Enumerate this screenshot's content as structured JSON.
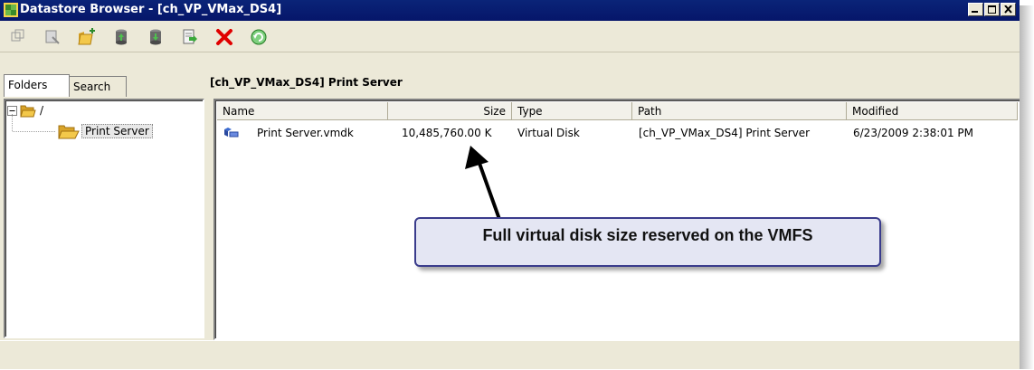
{
  "window": {
    "title": "Datastore Browser - [ch_VP_VMax_DS4]",
    "controls": [
      "minimize",
      "maximize",
      "close"
    ]
  },
  "toolbar": {
    "buttons": [
      {
        "icon": "datastore-action-icon",
        "enabled": false
      },
      {
        "icon": "browse-action-icon",
        "enabled": false
      },
      {
        "icon": "new-folder-icon",
        "enabled": true
      },
      {
        "icon": "upload-icon",
        "enabled": true
      },
      {
        "icon": "download-icon",
        "enabled": true
      },
      {
        "icon": "register-vm-icon",
        "enabled": true
      },
      {
        "icon": "delete-icon",
        "enabled": true
      },
      {
        "icon": "refresh-icon",
        "enabled": true
      }
    ]
  },
  "tabs": [
    {
      "label": "Folders",
      "active": true
    },
    {
      "label": "Search",
      "active": false
    }
  ],
  "tree": {
    "root": {
      "label": "/",
      "expanded": true
    },
    "children": [
      {
        "label": "Print Server",
        "selected": true
      }
    ]
  },
  "path_label": "[ch_VP_VMax_DS4] Print Server",
  "table": {
    "columns": [
      "Name",
      "Size",
      "Type",
      "Path",
      "Modified"
    ],
    "rows": [
      {
        "name": "Print Server.vmdk",
        "size": "10,485,760.00 K",
        "type": "Virtual Disk",
        "path": "[ch_VP_VMax_DS4] Print Server",
        "modified": "6/23/2009 2:38:01 PM"
      }
    ]
  },
  "callout": {
    "text": "Full virtual disk size reserved on the VMFS"
  },
  "colors": {
    "titlebar": "#0a2478",
    "window_bg": "#ece9d8",
    "callout_bg": "#e4e6f3",
    "callout_border": "#3a3c8c",
    "delete_red": "#e00000",
    "refresh_green": "#2ea82e",
    "folder_yellow": "#f3c84a"
  }
}
